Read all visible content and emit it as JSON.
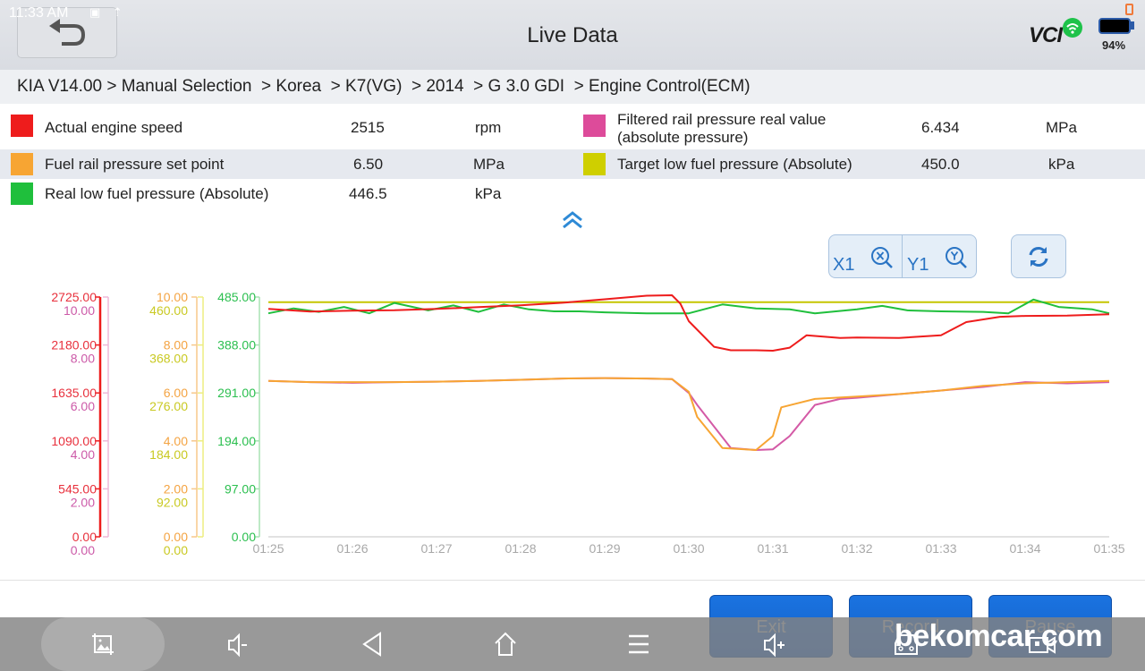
{
  "status_bar": {
    "time": "11:33 AM",
    "battery_percent": "94%"
  },
  "header": {
    "title": "Live Data",
    "vci_label": "VCI",
    "back_icon": "back-arrow-icon"
  },
  "breadcrumb": {
    "items": [
      "KIA V14.00",
      "Manual Selection",
      "Korea",
      "K7(VG)",
      "2014",
      "G 3.0 GDI",
      "Engine Control(ECM)"
    ],
    "text": "KIA V14.00 > Manual Selection  > Korea  > K7(VG)  > 2014  > G 3.0 GDI  > Engine Control(ECM)"
  },
  "parameters": [
    {
      "name": "Actual engine speed",
      "value": "2515",
      "unit": "rpm",
      "color": "#ee1c1c"
    },
    {
      "name": "Filtered rail pressure real value\n(absolute pressure)",
      "name_line1": "Filtered rail pressure real value",
      "name_line2": "(absolute pressure)",
      "value": "6.434",
      "unit": "MPa",
      "color": "#dd4b9a"
    },
    {
      "name": "Fuel rail pressure set point",
      "value": "6.50",
      "unit": "MPa",
      "color": "#f7a533"
    },
    {
      "name": "Target low fuel pressure (Absolute)",
      "value": "450.0",
      "unit": "kPa",
      "color": "#cfcf00"
    },
    {
      "name": "Real low fuel pressure (Absolute)",
      "value": "446.5",
      "unit": "kPa",
      "color": "#1fbf3c"
    }
  ],
  "controls": {
    "x_zoom_label": "X1",
    "y_zoom_label": "Y1"
  },
  "actions": {
    "exit": "Exit",
    "record": "Record",
    "pause": "Pause"
  },
  "watermark": "bekomcar.com",
  "chart_data": {
    "type": "line",
    "title": "",
    "xlabel": "",
    "x_ticks": [
      "01:25",
      "01:26",
      "01:27",
      "01:28",
      "01:29",
      "01:30",
      "01:31",
      "01:32",
      "01:33",
      "01:34",
      "01:35"
    ],
    "x_range_minutes": [
      0,
      10
    ],
    "grid": false,
    "axes": [
      {
        "series": "Actual engine speed",
        "unit": "rpm",
        "range": [
          0,
          2725
        ],
        "ticks": [
          "2725.00",
          "2180.00",
          "1635.00",
          "1090.00",
          "545.00",
          "0.00"
        ],
        "color": "#ee1c1c"
      },
      {
        "series": "Filtered rail pressure real value (absolute pressure)",
        "unit": "MPa",
        "range": [
          0,
          10
        ],
        "ticks": [
          "10.00",
          "8.00",
          "6.00",
          "4.00",
          "2.00",
          "0.00"
        ],
        "color": "#d45aa6"
      },
      {
        "series": "Fuel rail pressure set point",
        "unit": "MPa",
        "range": [
          0,
          10
        ],
        "ticks": [
          "10.00",
          "8.00",
          "6.00",
          "4.00",
          "2.00",
          "0.00"
        ],
        "color": "#f7a533"
      },
      {
        "series": "Target low fuel pressure (Absolute)",
        "unit": "kPa",
        "range": [
          0,
          460
        ],
        "ticks": [
          "460.00",
          "368.00",
          "276.00",
          "184.00",
          "92.00",
          "0.00"
        ],
        "color": "#c6c600"
      },
      {
        "series": "Real low fuel pressure (Absolute)",
        "unit": "kPa",
        "range": [
          0,
          485
        ],
        "ticks": [
          "485.00",
          "388.00",
          "291.00",
          "194.00",
          "97.00",
          "0.00"
        ],
        "color": "#1fbf3c"
      }
    ],
    "series": [
      {
        "name": "Actual engine speed",
        "color": "#ee1c1c",
        "x": [
          0,
          0.5,
          1,
          1.5,
          2,
          2.5,
          3,
          3.5,
          4,
          4.5,
          4.8,
          4.9,
          5,
          5.3,
          5.5,
          5.8,
          6,
          6.2,
          6.4,
          6.8,
          7,
          7.5,
          8,
          8.3,
          8.7,
          9,
          9.5,
          10
        ],
        "values": [
          2590,
          2560,
          2570,
          2575,
          2590,
          2610,
          2630,
          2660,
          2700,
          2740,
          2745,
          2650,
          2450,
          2160,
          2120,
          2120,
          2115,
          2150,
          2290,
          2260,
          2265,
          2260,
          2290,
          2440,
          2500,
          2510,
          2515,
          2530
        ]
      },
      {
        "name": "Filtered rail pressure real value (absolute pressure)",
        "color": "#d45aa6",
        "x": [
          0,
          0.5,
          1,
          1.5,
          2,
          2.5,
          3,
          3.5,
          4,
          4.5,
          4.8,
          5,
          5.1,
          5.5,
          5.8,
          6,
          6.2,
          6.5,
          6.8,
          7,
          7.5,
          8,
          8.5,
          9,
          9.5,
          10
        ],
        "values": [
          6.5,
          6.45,
          6.42,
          6.45,
          6.47,
          6.5,
          6.55,
          6.6,
          6.62,
          6.6,
          6.58,
          6.0,
          5.5,
          3.7,
          3.62,
          3.65,
          4.2,
          5.5,
          5.75,
          5.8,
          5.95,
          6.1,
          6.25,
          6.45,
          6.4,
          6.45
        ]
      },
      {
        "name": "Fuel rail pressure set point",
        "color": "#f7a533",
        "x": [
          0,
          0.5,
          1,
          1.5,
          2,
          2.5,
          3,
          3.5,
          4,
          4.5,
          4.8,
          5,
          5.1,
          5.4,
          5.8,
          6,
          6.1,
          6.5,
          7,
          7.5,
          8,
          8.5,
          9,
          9.5,
          10
        ],
        "values": [
          6.5,
          6.45,
          6.45,
          6.45,
          6.47,
          6.5,
          6.55,
          6.6,
          6.62,
          6.6,
          6.58,
          6.05,
          5.0,
          3.7,
          3.62,
          4.2,
          5.4,
          5.75,
          5.85,
          5.95,
          6.1,
          6.3,
          6.4,
          6.45,
          6.5
        ]
      },
      {
        "name": "Target low fuel pressure (Absolute)",
        "color": "#c6c600",
        "x": [
          0,
          10
        ],
        "values": [
          450,
          450
        ]
      },
      {
        "name": "Real low fuel pressure (Absolute)",
        "color": "#1fbf3c",
        "x": [
          0,
          0.3,
          0.6,
          0.9,
          1.2,
          1.5,
          1.9,
          2.2,
          2.5,
          2.8,
          3.1,
          3.4,
          3.7,
          4,
          4.5,
          5,
          5.4,
          5.8,
          6.2,
          6.5,
          7,
          7.3,
          7.6,
          8,
          8.5,
          8.8,
          9.1,
          9.4,
          9.8,
          10
        ],
        "values": [
          452,
          462,
          455,
          465,
          452,
          473,
          458,
          468,
          455,
          470,
          460,
          456,
          456,
          454,
          452,
          452,
          470,
          462,
          460,
          452,
          460,
          467,
          458,
          456,
          455,
          452,
          480,
          465,
          460,
          452
        ]
      }
    ]
  }
}
